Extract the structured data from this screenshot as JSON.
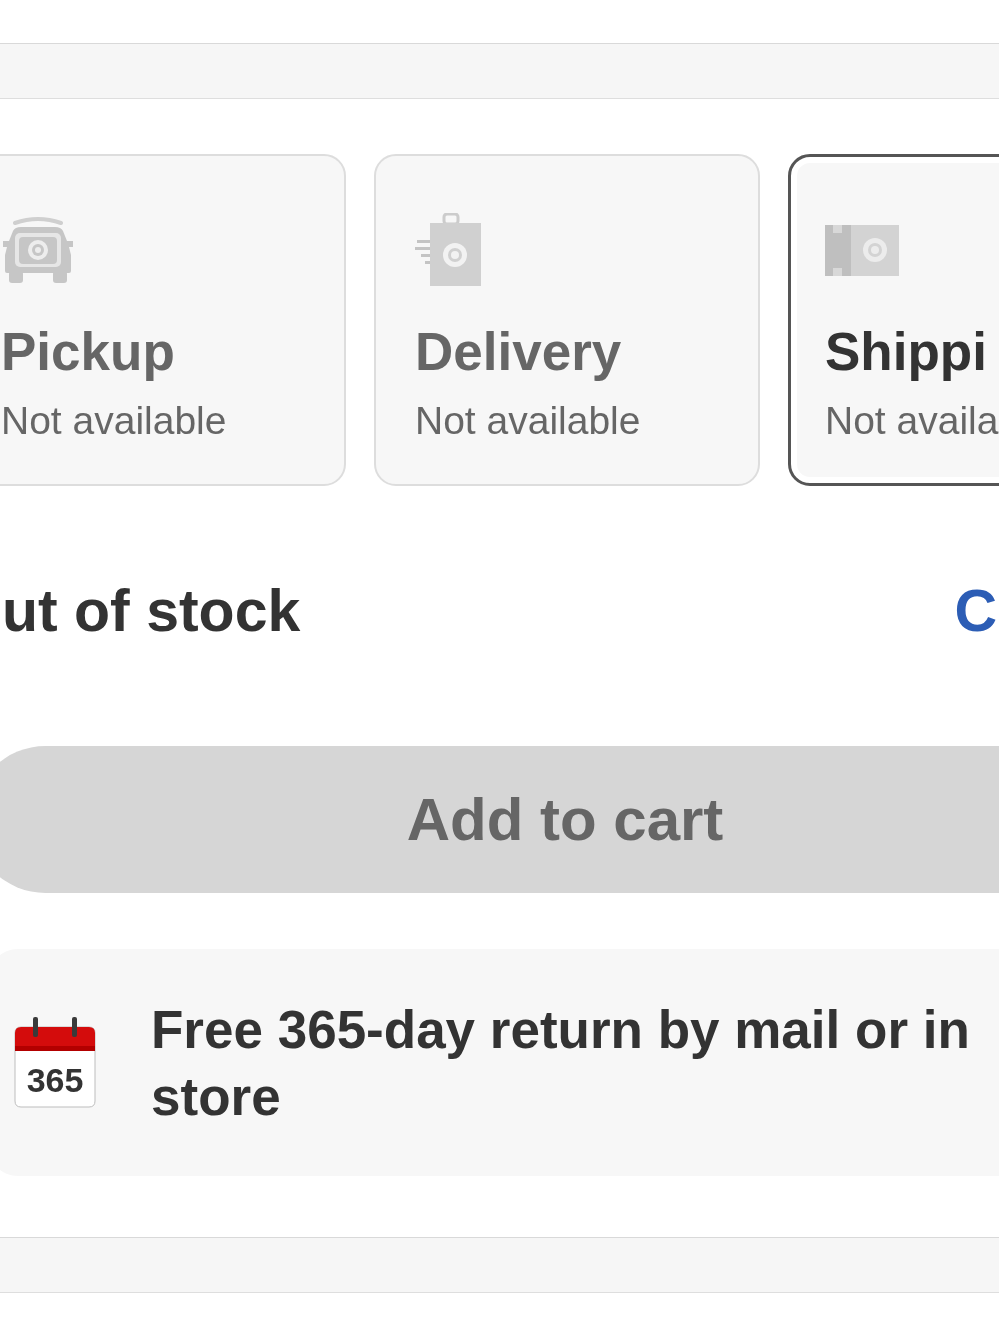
{
  "fulfillment_options": [
    {
      "kind": "pickup",
      "title": "Pickup",
      "status": "Not available",
      "selected": false
    },
    {
      "kind": "delivery",
      "title": "Delivery",
      "status": "Not available",
      "selected": false
    },
    {
      "kind": "shipping",
      "title": "Shippi",
      "status": "Not availa",
      "selected": true
    }
  ],
  "stock": {
    "status": "ut of stock",
    "link": "C"
  },
  "add_to_cart": {
    "label": "Add to cart",
    "disabled": true
  },
  "returns": {
    "badge": "365",
    "text": "Free 365-day return by mail or in store"
  }
}
